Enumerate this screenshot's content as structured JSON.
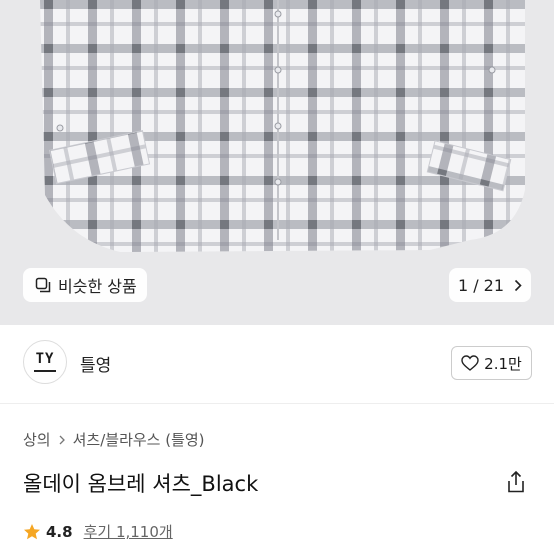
{
  "hero": {
    "similar_label": "비슷한 상품",
    "counter": "1 / 21"
  },
  "brand": {
    "logo_text": "TY",
    "name": "틀영",
    "likes": "2.1만"
  },
  "breadcrumb": [
    "상의",
    "셔츠/블라우스 (틀영)"
  ],
  "product": {
    "title": "올데이 옴브레 셔츠_Black",
    "rating": "4.8",
    "reviews": "후기 1,110개"
  },
  "colors": {
    "star": "#f5a623",
    "hero_bg": "#e8e8ea"
  },
  "icons": [
    "similar-icon",
    "chevron-right-icon",
    "heart-icon",
    "share-icon",
    "star-icon"
  ]
}
